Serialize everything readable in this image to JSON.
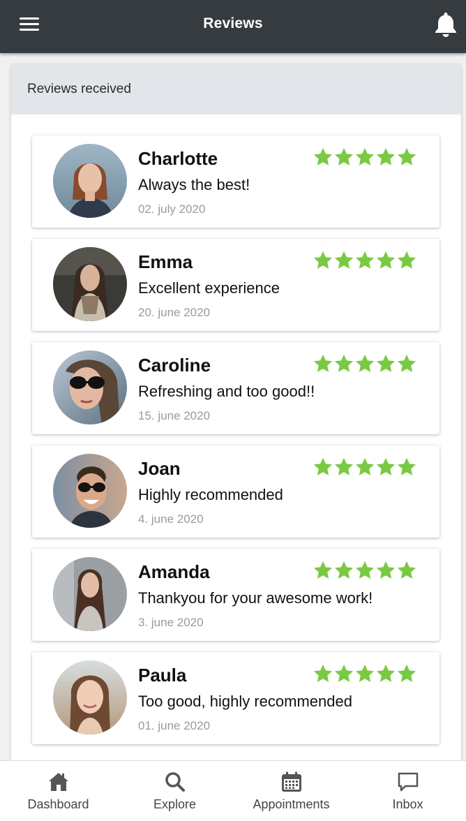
{
  "header": {
    "title": "Reviews",
    "menu_icon": "hamburger-menu-icon",
    "notifications_icon": "bell-icon"
  },
  "panel": {
    "title": "Reviews received"
  },
  "rating_color": "#7ac943",
  "reviews": [
    {
      "name": "Charlotte",
      "comment": "Always the best!",
      "date": "02. july 2020",
      "rating": 5
    },
    {
      "name": "Emma",
      "comment": "Excellent experience",
      "date": "20. june 2020",
      "rating": 5
    },
    {
      "name": "Caroline",
      "comment": "Refreshing and too good!!",
      "date": "15. june 2020",
      "rating": 5
    },
    {
      "name": "Joan",
      "comment": "Highly recommended",
      "date": "4. june 2020",
      "rating": 5
    },
    {
      "name": "Amanda",
      "comment": "Thankyou for your awesome work!",
      "date": "3. june 2020",
      "rating": 5
    },
    {
      "name": "Paula",
      "comment": "Too good, highly recommended",
      "date": "01. june 2020",
      "rating": 5
    }
  ],
  "bottom_nav": {
    "items": [
      {
        "label": "Dashboard",
        "icon": "home-icon"
      },
      {
        "label": "Explore",
        "icon": "search-icon"
      },
      {
        "label": "Appointments",
        "icon": "calendar-icon"
      },
      {
        "label": "Inbox",
        "icon": "chat-bubble-icon"
      }
    ]
  }
}
